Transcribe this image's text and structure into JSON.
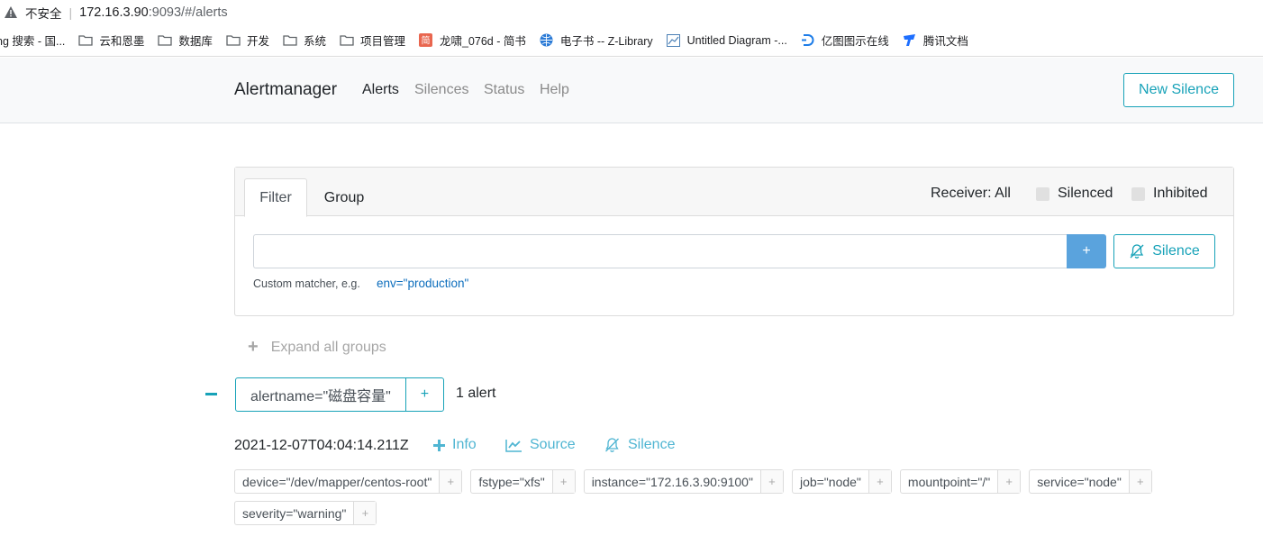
{
  "browser": {
    "insecure_label": "不安全",
    "url_host": "172.16.3.90",
    "url_rest": ":9093/#/alerts"
  },
  "bookmarks": [
    {
      "label": "ng 搜索 - 国...",
      "icon": "none"
    },
    {
      "label": "云和恩墨",
      "icon": "folder-icon"
    },
    {
      "label": "数据库",
      "icon": "folder-icon"
    },
    {
      "label": "开发",
      "icon": "folder-icon"
    },
    {
      "label": "系统",
      "icon": "folder-icon"
    },
    {
      "label": "项目管理",
      "icon": "folder-icon"
    },
    {
      "label": "龙啸_076d - 简书",
      "icon": "jianshu-icon"
    },
    {
      "label": "电子书 -- Z-Library",
      "icon": "globe-icon"
    },
    {
      "label": "Untitled Diagram -...",
      "icon": "diagram-icon"
    },
    {
      "label": "亿图图示在线",
      "icon": "edraw-icon"
    },
    {
      "label": "腾讯文档",
      "icon": "tencent-docs-icon"
    }
  ],
  "nav": {
    "brand": "Alertmanager",
    "links": [
      "Alerts",
      "Silences",
      "Status",
      "Help"
    ],
    "active": "Alerts",
    "new_silence": "New Silence"
  },
  "filter": {
    "tabs": [
      "Filter",
      "Group"
    ],
    "receiver": "Receiver: All",
    "silenced": "Silenced",
    "inhibited": "Inhibited",
    "input_value": "",
    "plus": "+",
    "silence_button": "Silence",
    "hint": "Custom matcher, e.g.",
    "hint_example": "env=\"production\""
  },
  "expand_all": "Expand all groups",
  "group": {
    "label": "alertname=\"磁盘容量\"",
    "plus": "+",
    "count": "1 alert"
  },
  "alert": {
    "timestamp": "2021-12-07T04:04:14.211Z",
    "info": "Info",
    "source": "Source",
    "silence": "Silence",
    "labels": [
      "device=\"/dev/mapper/centos-root\"",
      "fstype=\"xfs\"",
      "instance=\"172.16.3.90:9100\"",
      "job=\"node\"",
      "mountpoint=\"/\"",
      "service=\"node\"",
      "severity=\"warning\""
    ]
  },
  "colors": {
    "accent": "#17a2b8",
    "primary_button": "#5aa3dd",
    "link": "#0d6ebd"
  }
}
